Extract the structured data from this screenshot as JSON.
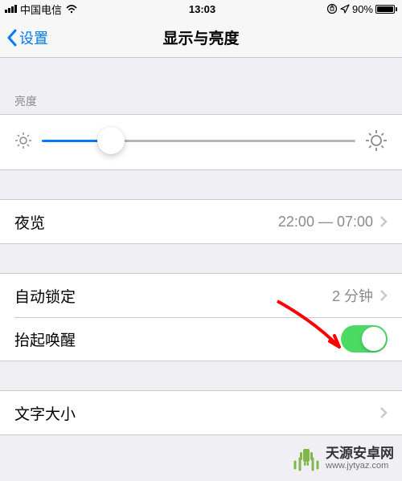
{
  "status": {
    "carrier": "中国电信",
    "time": "13:03",
    "battery_pct": "90%"
  },
  "nav": {
    "back": "设置",
    "title": "显示与亮度"
  },
  "brightness": {
    "header": "亮度",
    "value_pct": 22
  },
  "night_shift": {
    "label": "夜览",
    "schedule": "22:00 — 07:00"
  },
  "auto_lock": {
    "label": "自动锁定",
    "value": "2 分钟"
  },
  "raise_to_wake": {
    "label": "抬起唤醒",
    "on": true
  },
  "text_size": {
    "label": "文字大小"
  },
  "watermark": {
    "title": "天源安卓网",
    "url": "www.jytyaz.com"
  }
}
